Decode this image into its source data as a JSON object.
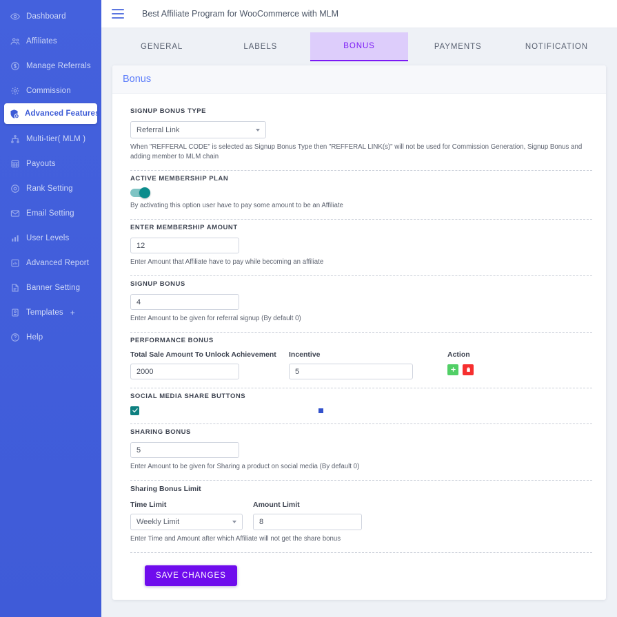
{
  "sidebar": {
    "items": [
      {
        "label": "Dashboard",
        "icon": "eye-icon",
        "active": false
      },
      {
        "label": "Affiliates",
        "icon": "users-icon",
        "active": false
      },
      {
        "label": "Manage Referrals",
        "icon": "refresh-dollar-icon",
        "active": false
      },
      {
        "label": "Commission",
        "icon": "gear-icon",
        "active": false
      },
      {
        "label": "Advanced Features",
        "icon": "shield-plus-icon",
        "active": true
      },
      {
        "label": "Multi-tier( MLM )",
        "icon": "network-icon",
        "active": false
      },
      {
        "label": "Payouts",
        "icon": "calculator-icon",
        "active": false
      },
      {
        "label": "Rank Setting",
        "icon": "circle-target-icon",
        "active": false
      },
      {
        "label": "Email Setting",
        "icon": "envelope-icon",
        "active": false
      },
      {
        "label": "User Levels",
        "icon": "bar-chart-icon",
        "active": false
      },
      {
        "label": "Advanced Report",
        "icon": "report-icon",
        "active": false
      },
      {
        "label": "Banner Setting",
        "icon": "banner-icon",
        "active": false
      },
      {
        "label": "Templates",
        "icon": "template-icon",
        "active": false,
        "suffix": "+"
      },
      {
        "label": "Help",
        "icon": "question-circle-icon",
        "active": false
      }
    ]
  },
  "header": {
    "menu_icon": "hamburger-icon",
    "title": "Best Affiliate Program for WooCommerce with MLM"
  },
  "tabs": [
    {
      "label": "GENERAL",
      "active": false
    },
    {
      "label": "LABELS",
      "active": false
    },
    {
      "label": "BONUS",
      "active": true
    },
    {
      "label": "PAYMENTS",
      "active": false
    },
    {
      "label": "NOTIFICATION",
      "active": false
    }
  ],
  "card": {
    "title": "Bonus"
  },
  "form": {
    "signup_bonus_type": {
      "label": "SIGNUP BONUS TYPE",
      "value": "Referral Link",
      "helper": "When \"REFFERAL CODE\" is selected as Signup Bonus Type then \"REFFERAL LINK(s)\" will not be used for Commission Generation, Signup Bonus and adding member to MLM chain"
    },
    "active_membership_plan": {
      "label": "ACTIVE MEMBERSHIP PLAN",
      "enabled": true,
      "helper": "By activating this option user have to pay some amount to be an Affiliate"
    },
    "membership_amount": {
      "label": "ENTER MEMBERSHIP AMOUNT",
      "value": "12",
      "helper": "Enter Amount that Affiliate have to pay while becoming an affiliate"
    },
    "signup_bonus": {
      "label": "SIGNUP BONUS",
      "value": "4",
      "helper": "Enter Amount to be given for referral signup (By default 0)"
    },
    "performance_bonus": {
      "label": "PERFORMANCE BONUS",
      "col_total_sale": "Total Sale Amount To Unlock Achievement",
      "col_incentive": "Incentive",
      "col_action": "Action",
      "total_sale_value": "2000",
      "incentive_value": "5",
      "add_icon": "plus-icon",
      "delete_icon": "trash-icon"
    },
    "social_media_share_buttons": {
      "label": "SOCIAL MEDIA SHARE BUTTONS",
      "checked": true,
      "check_icon": "checkmark-icon"
    },
    "sharing_bonus": {
      "label": "SHARING BONUS",
      "value": "5",
      "helper": "Enter Amount to be given for Sharing a product on social media (By default 0)"
    },
    "sharing_bonus_limit": {
      "label": "Sharing Bonus Limit",
      "time_limit_label": "Time Limit",
      "time_limit_value": "Weekly Limit",
      "amount_limit_label": "Amount Limit",
      "amount_limit_value": "8",
      "helper": "Enter Time and Amount after which Affiliate will not get the share bonus"
    },
    "save_label": "SAVE CHANGES"
  },
  "colors": {
    "sidebar": "#4461dd",
    "accent_purple": "#7b19f5",
    "save_button": "#6f0ced",
    "toggle_on": "#0c8c8c",
    "checkbox": "#0e8080",
    "add_green": "#51cf66",
    "delete_red": "#f62f2f",
    "card_title": "#5b7cfa"
  }
}
